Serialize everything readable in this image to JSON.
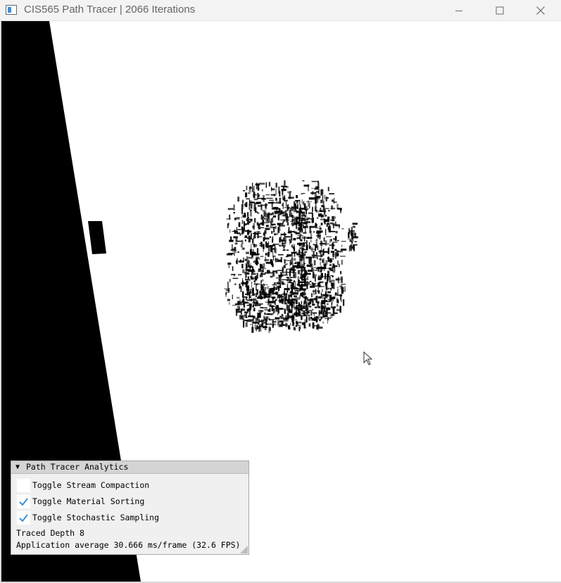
{
  "window": {
    "title": "CIS565 Path Tracer | 2066 Iterations",
    "icon": "app-window-icon",
    "controls": {
      "minimize": "minimize-icon",
      "maximize": "maximize-icon",
      "close": "close-icon"
    }
  },
  "analytics_panel": {
    "title": "Path Tracer Analytics",
    "collapse_icon": "collapse-arrow-icon",
    "options": [
      {
        "label": "Toggle Stream Compaction",
        "checked": false
      },
      {
        "label": "Toggle Material Sorting",
        "checked": true
      },
      {
        "label": "Toggle Stochastic Sampling",
        "checked": true
      }
    ],
    "traced_depth": "Traced Depth 8",
    "average": "Application average 30.666 ms/frame (32.6 FPS)",
    "resize_icon": "resize-grip-icon"
  },
  "colors": {
    "background": "#ffffff",
    "scene_dark": "#000000",
    "checkmark": "#3f8fd8",
    "titlebar": "#f3f3f3"
  },
  "cursor": {
    "icon": "mouse-pointer-icon"
  }
}
